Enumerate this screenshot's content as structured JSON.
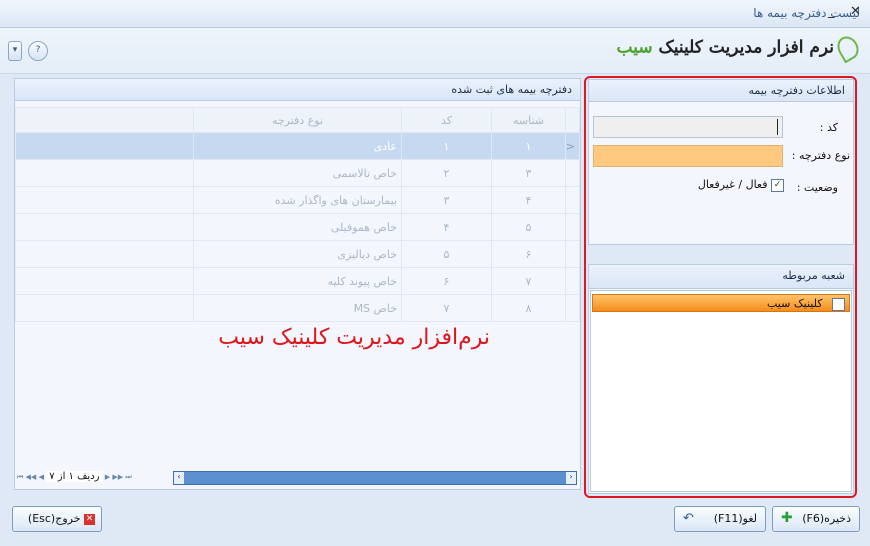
{
  "window": {
    "title": "لیست دفترچه بیمه ها",
    "close_glyph": "✕",
    "pin_glyph": "_"
  },
  "toolbar": {
    "help_glyph": "?",
    "dropdown_glyph": "▾"
  },
  "logo": {
    "text_main": "نرم افزار مدیریت کلینیک",
    "text_accent": "سیب",
    "brand_color": "#4aa42c"
  },
  "grid_panel": {
    "title": "دفترچه بیمه های ثبت شده",
    "columns": [
      "شناسه",
      "کد",
      "نوع دفترچه"
    ],
    "rows": [
      [
        "۱",
        "۱",
        "عادی"
      ],
      [
        "۳",
        "۲",
        "خاص تالاسمی"
      ],
      [
        "۴",
        "۳",
        "بیمارستان های واگذار شده"
      ],
      [
        "۵",
        "۴",
        "خاص هموفیلی"
      ],
      [
        "۶",
        "۵",
        "خاص دیالیزی"
      ],
      [
        "۷",
        "۶",
        "خاص پیوند کلیه"
      ],
      [
        "۸",
        "۷",
        "خاص MS"
      ]
    ],
    "selected_row": 0,
    "row_indicator": "<",
    "nav": {
      "record_text": "ردیف ۱ از ۷",
      "first": "⏮",
      "prev_page": "◀◀",
      "prev": "◀",
      "next": "▶",
      "next_page": "▶▶",
      "last": "⏭"
    }
  },
  "watermark": {
    "text": "نرم‌افزار مدیریت کلینیک سیب",
    "color": "#e0141a"
  },
  "info_panel": {
    "title": "اطلاعات دفترچه بیمه",
    "code_label": "کد :",
    "code_value": "",
    "type_label": "نوع دفترچه :",
    "type_value": "",
    "status_label": "وضعیت :",
    "status_checkbox_text": "فعال / غیرفعال",
    "status_checked": true
  },
  "branch_panel": {
    "title": "شعبه مربوطه",
    "items": [
      {
        "label": "کلینیک سیب",
        "checked": false
      }
    ]
  },
  "buttons": {
    "save": "ذخیره(F6)",
    "cancel": "لغو(F11)",
    "exit": "خروج(Esc)"
  },
  "colors": {
    "highlight_border": "#e01620",
    "type_field_bg": "#ffc97f",
    "branch_item": "#f5921e"
  }
}
